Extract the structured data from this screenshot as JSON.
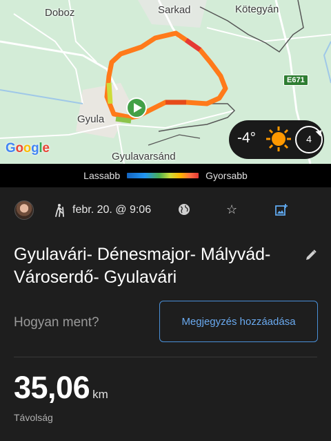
{
  "map": {
    "places": {
      "doboz": "Doboz",
      "sarkad": "Sarkad",
      "kotegyan": "Kötegyán",
      "gyula": "Gyula",
      "gyulavarsand": "Gyulavarsánd"
    },
    "road_badge": "E671",
    "google_logo": [
      "G",
      "o",
      "o",
      "g",
      "l",
      "e"
    ],
    "google_colors": [
      "#4285F4",
      "#EA4335",
      "#FBBC05",
      "#4285F4",
      "#34A853",
      "#EA4335"
    ],
    "weather": {
      "temperature": "-4°",
      "wind": "4",
      "icon": "sun-icon"
    }
  },
  "legend": {
    "slow": "Lassabb",
    "fast": "Gyorsabb"
  },
  "activity": {
    "type_icon": "hiker-icon",
    "date": "febr. 20. @ 9:06",
    "title": "Gyulavári- Dénesmajor- Mályvád- Városerdő- Gyulavári",
    "how_prompt": "Hogyan ment?",
    "add_note_label": "Megjegyzés hozzáadása",
    "distance_value": "35,06",
    "distance_unit": "km",
    "distance_label": "Távolság"
  },
  "colors": {
    "accent": "#4a90d9",
    "route_slow": "#1565c0",
    "route_fast": "#e53935",
    "start_marker": "#43a047"
  }
}
